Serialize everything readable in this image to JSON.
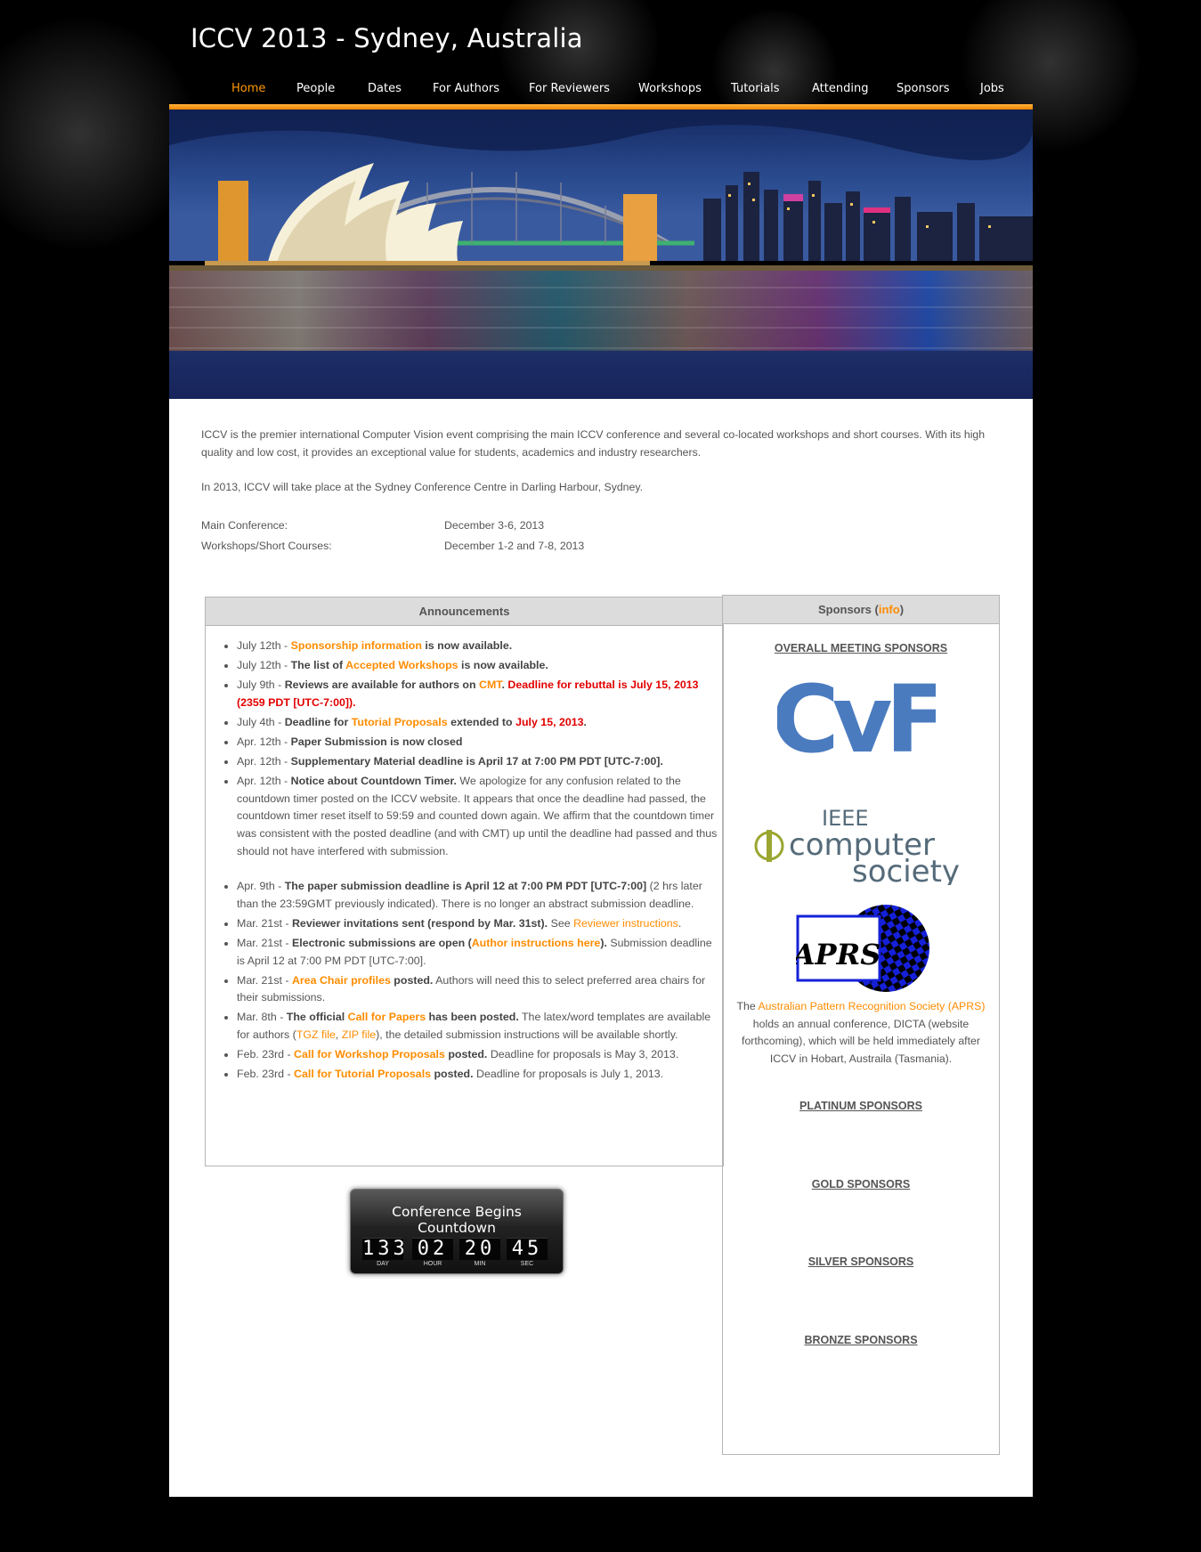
{
  "header": {
    "title": "ICCV 2013 - Sydney, Australia"
  },
  "nav": {
    "items": [
      "Home",
      "People",
      "Dates",
      "For Authors",
      "For Reviewers",
      "Workshops",
      "Tutorials",
      "Attending",
      "Sponsors",
      "Jobs"
    ],
    "active": "Home"
  },
  "colors": {
    "accent": "#ff8c00",
    "alert": "#e10000",
    "text": "#555555",
    "box_header": "#dcdcdc"
  },
  "intro": {
    "p1": "ICCV is the premier international Computer Vision event comprising the main ICCV conference and several co-located workshops and short courses. With its high quality and low cost, it provides an exceptional value for students, academics and industry researchers.",
    "p2": "In 2013, ICCV will take place at the Sydney Conference Centre in Darling Harbour, Sydney.",
    "dates": [
      {
        "label": "Main Conference:",
        "value": "December 3-6, 2013"
      },
      {
        "label": "Workshops/Short Courses:",
        "value": "December 1-2 and 7-8, 2013"
      }
    ]
  },
  "announcements": {
    "title": "Announcements",
    "items": [
      {
        "date": "July 12th - ",
        "parts": [
          {
            "t": "Sponsorship information",
            "s": "o"
          },
          {
            "t": " is now available.",
            "s": "b"
          }
        ]
      },
      {
        "date": "July 12th - ",
        "parts": [
          {
            "t": "The list of ",
            "s": "b"
          },
          {
            "t": "Accepted Workshops",
            "s": "o"
          },
          {
            "t": " is now available.",
            "s": "b"
          }
        ]
      },
      {
        "date": "July 9th - ",
        "parts": [
          {
            "t": "Reviews are available for authors on ",
            "s": "b"
          },
          {
            "t": "CMT",
            "s": "o"
          },
          {
            "t": ". ",
            "s": "b"
          },
          {
            "t": "Deadline for rebuttal is July 15, 2013 (2359 PDT [UTC-7:00]).",
            "s": "r"
          }
        ]
      },
      {
        "date": "July 4th - ",
        "parts": [
          {
            "t": "Deadline for ",
            "s": "b"
          },
          {
            "t": "Tutorial Proposals",
            "s": "o"
          },
          {
            "t": " extended to ",
            "s": "b"
          },
          {
            "t": "July 15, 2013",
            "s": "r"
          },
          {
            "t": ".",
            "s": "b"
          }
        ]
      },
      {
        "date": "Apr. 12th - ",
        "parts": [
          {
            "t": "Paper Submission is now closed",
            "s": "b"
          }
        ]
      },
      {
        "date": "Apr. 12th - ",
        "parts": [
          {
            "t": "Supplementary Material deadline is April 17 at 7:00 PM PDT [UTC-7:00].",
            "s": "b"
          }
        ]
      },
      {
        "date": "Apr. 12th - ",
        "spaced": true,
        "parts": [
          {
            "t": "Notice about Countdown Timer.",
            "s": "b"
          },
          {
            "t": " We apologize for any confusion related to the countdown timer posted on the ICCV website. It appears that once the deadline had passed, the countdown timer reset itself to 59:59 and counted down again. We affirm that the countdown timer was consistent with the posted deadline (and with CMT) up until the deadline had passed and thus should not have interfered with submission.",
            "s": "n"
          }
        ]
      },
      {
        "date": "Apr. 9th - ",
        "parts": [
          {
            "t": "The paper submission deadline is April 12 at 7:00 PM PDT [UTC-7:00]",
            "s": "b"
          },
          {
            "t": " (2 hrs later than the 23:59GMT previously indicated). There is no longer an abstract submission deadline.",
            "s": "n"
          }
        ]
      },
      {
        "date": "Mar. 21st - ",
        "parts": [
          {
            "t": "Reviewer invitations sent (respond by Mar. 31st).",
            "s": "b"
          },
          {
            "t": " See ",
            "s": "n"
          },
          {
            "t": "Reviewer instructions",
            "s": "on"
          },
          {
            "t": ".",
            "s": "n"
          }
        ]
      },
      {
        "date": "Mar. 21st - ",
        "parts": [
          {
            "t": "Electronic submissions are open (",
            "s": "b"
          },
          {
            "t": "Author instructions here",
            "s": "o"
          },
          {
            "t": ").",
            "s": "b"
          },
          {
            "t": " Submission deadline is April 12 at 7:00 PM PDT [UTC-7:00].",
            "s": "n"
          }
        ]
      },
      {
        "date": "Mar. 21st - ",
        "parts": [
          {
            "t": "Area Chair profiles",
            "s": "o"
          },
          {
            "t": " posted.",
            "s": "b"
          },
          {
            "t": " Authors will need this to select preferred area chairs for their submissions.",
            "s": "n"
          }
        ]
      },
      {
        "date": "Mar. 8th - ",
        "parts": [
          {
            "t": "The official ",
            "s": "b"
          },
          {
            "t": "Call for Papers",
            "s": "o"
          },
          {
            "t": " has been posted.",
            "s": "b"
          },
          {
            "t": " The latex/word templates are available for authors (",
            "s": "n"
          },
          {
            "t": "TGZ file",
            "s": "on"
          },
          {
            "t": ", ",
            "s": "n"
          },
          {
            "t": "ZIP file",
            "s": "on"
          },
          {
            "t": "), the detailed submission instructions will be available shortly.",
            "s": "n"
          }
        ]
      },
      {
        "date": "Feb. 23rd - ",
        "parts": [
          {
            "t": "Call for Workshop Proposals",
            "s": "o"
          },
          {
            "t": " posted.",
            "s": "b"
          },
          {
            "t": " Deadline for proposals is May 3, 2013.",
            "s": "n"
          }
        ]
      },
      {
        "date": "Feb. 23rd - ",
        "parts": [
          {
            "t": "Call for Tutorial Proposals",
            "s": "o"
          },
          {
            "t": " posted.",
            "s": "b"
          },
          {
            "t": " Deadline for proposals is July 1, 2013.",
            "s": "n"
          }
        ]
      }
    ]
  },
  "countdown": {
    "title": "Conference Begins Countdown",
    "units": [
      {
        "value": "133",
        "label": "DAY"
      },
      {
        "value": "02",
        "label": "HOUR"
      },
      {
        "value": "20",
        "label": "MIN"
      },
      {
        "value": "45",
        "label": "SEC"
      }
    ]
  },
  "sponsors": {
    "title_prefix": "Sponsors (",
    "title_link": "info",
    "title_suffix": ")",
    "overall": "OVERALL MEETING SPONSORS",
    "cvf_logo": "CvF",
    "ieee_line1": "IEEE",
    "ieee_line2": "computer",
    "ieee_line3": "society",
    "aprs_logo": "APRS",
    "aprs_text_pre": "The ",
    "aprs_link": "Australian Pattern Recognition Society (APRS)",
    "aprs_text_post": " holds an annual conference, DICTA (website forthcoming), which will be held immediately after ICCV in Hobart, Austraila (Tasmania).",
    "platinum": "PLATINUM SPONSORS",
    "gold": "GOLD SPONSORS",
    "silver": "SILVER SPONSORS",
    "bronze": "BRONZE SPONSORS"
  }
}
